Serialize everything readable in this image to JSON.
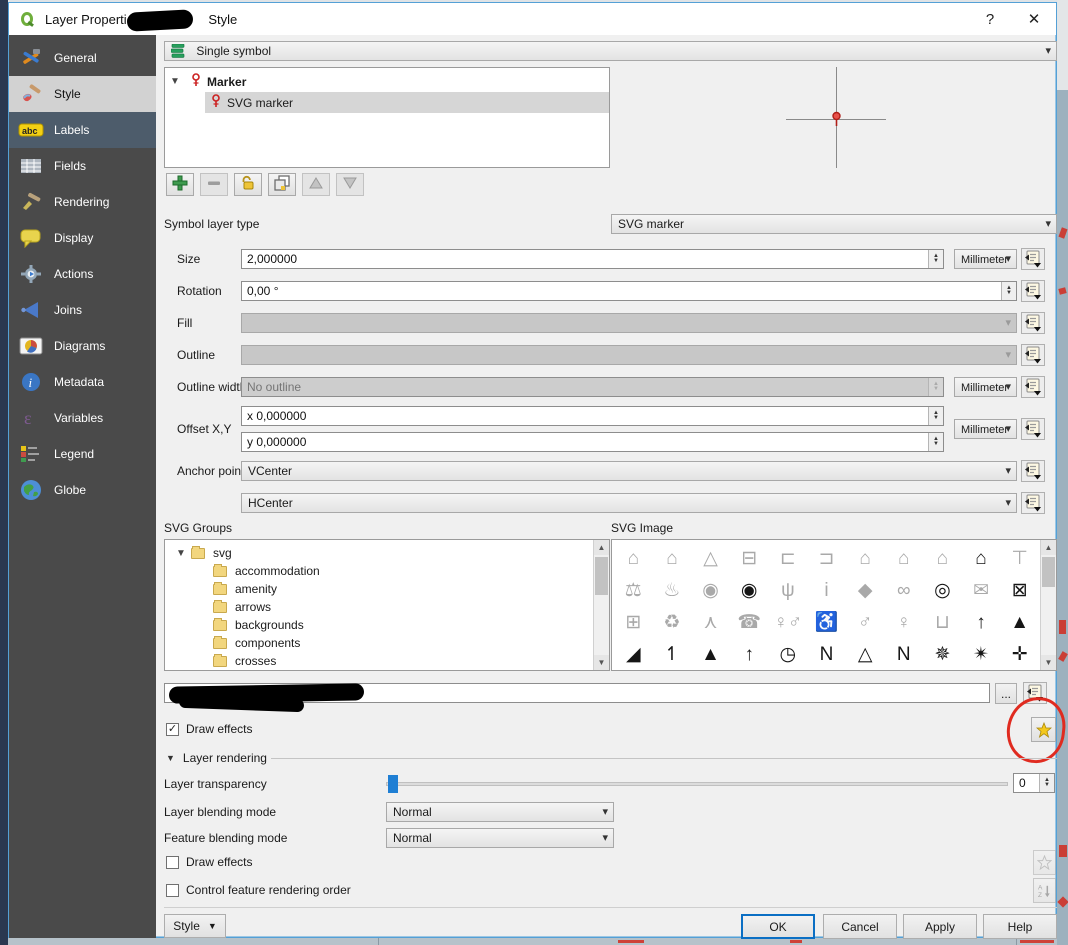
{
  "window": {
    "title": "Layer Properties - ",
    "title_suffix": "Style",
    "help_glyph": "?",
    "close_glyph": "✕"
  },
  "sidebar": {
    "items": [
      {
        "label": "General",
        "icon": "tools-icon",
        "name": "sidebar-item-general",
        "variant": "default"
      },
      {
        "label": "Style",
        "icon": "brush-icon",
        "name": "sidebar-item-style",
        "variant": "selected"
      },
      {
        "label": "Labels",
        "icon": "abc-icon",
        "name": "sidebar-item-labels",
        "variant": "tinted"
      },
      {
        "label": "Fields",
        "icon": "table-icon",
        "name": "sidebar-item-fields",
        "variant": "default"
      },
      {
        "label": "Rendering",
        "icon": "brush2-icon",
        "name": "sidebar-item-rendering",
        "variant": "default"
      },
      {
        "label": "Display",
        "icon": "bubble-icon",
        "name": "sidebar-item-display",
        "variant": "default"
      },
      {
        "label": "Actions",
        "icon": "gear-icon",
        "name": "sidebar-item-actions",
        "variant": "default"
      },
      {
        "label": "Joins",
        "icon": "megaphone-icon",
        "name": "sidebar-item-joins",
        "variant": "default"
      },
      {
        "label": "Diagrams",
        "icon": "chart-icon",
        "name": "sidebar-item-diagrams",
        "variant": "default"
      },
      {
        "label": "Metadata",
        "icon": "info-icon",
        "name": "sidebar-item-metadata",
        "variant": "default"
      },
      {
        "label": "Variables",
        "icon": "epsilon-icon",
        "name": "sidebar-item-variables",
        "variant": "default"
      },
      {
        "label": "Legend",
        "icon": "legend-icon",
        "name": "sidebar-item-legend",
        "variant": "default"
      },
      {
        "label": "Globe",
        "icon": "globe-icon",
        "name": "sidebar-item-globe",
        "variant": "default"
      }
    ]
  },
  "symbology": {
    "renderer": "Single symbol",
    "tree_parent": "Marker",
    "tree_child": "SVG marker"
  },
  "symbol_toolbar": {
    "buttons": [
      {
        "name": "add-symbol-layer-button",
        "icon": "plus-icon",
        "enabled": true
      },
      {
        "name": "remove-symbol-layer-button",
        "icon": "minus-icon",
        "enabled": false
      },
      {
        "name": "lock-color-button",
        "icon": "lock-icon",
        "enabled": true
      },
      {
        "name": "duplicate-symbol-layer-button",
        "icon": "duplicate-icon",
        "enabled": true
      },
      {
        "name": "move-up-button",
        "icon": "up-icon",
        "enabled": false
      },
      {
        "name": "move-down-button",
        "icon": "down-icon",
        "enabled": false
      }
    ]
  },
  "form": {
    "symbol_layer_type": {
      "label": "Symbol layer type",
      "value": "SVG marker"
    },
    "size": {
      "label": "Size",
      "value": "2,000000",
      "unit": "Millimeter"
    },
    "rotation": {
      "label": "Rotation",
      "value": "0,00 °"
    },
    "fill": {
      "label": "Fill"
    },
    "outline": {
      "label": "Outline"
    },
    "outline_width": {
      "label": "Outline width",
      "placeholder": "No outline",
      "unit": "Millimeter"
    },
    "offset": {
      "label": "Offset X,Y",
      "x_value": "x 0,000000",
      "y_value": "y 0,000000",
      "unit": "Millimeter"
    },
    "anchor": {
      "label": "Anchor point",
      "v_value": "VCenter",
      "h_value": "HCenter"
    }
  },
  "svg_groups": {
    "label": "SVG Groups",
    "root": "svg",
    "folders": [
      "accommodation",
      "amenity",
      "arrows",
      "backgrounds",
      "components",
      "crosses"
    ]
  },
  "svg_image": {
    "label": "SVG Image",
    "icons": [
      {
        "n": "shelter-hiker-icon",
        "g": "⌂",
        "c": "g"
      },
      {
        "n": "bed-breakfast-house-icon",
        "g": "⌂",
        "c": "g"
      },
      {
        "n": "tent-icon",
        "g": "△",
        "c": "g"
      },
      {
        "n": "caravan-icon",
        "g": "⊟",
        "c": "g"
      },
      {
        "n": "bed-breakfast-icon",
        "g": "⊏",
        "c": "g"
      },
      {
        "n": "hotel-bed-icon",
        "g": "⊐",
        "c": "g"
      },
      {
        "n": "house-icon",
        "g": "⌂",
        "c": "g"
      },
      {
        "n": "rain-shelter-icon",
        "g": "⌂",
        "c": "g"
      },
      {
        "n": "rain-shelter2-icon",
        "g": "⌂",
        "c": "g"
      },
      {
        "n": "house-trees-icon",
        "g": "⌂",
        "c": "b"
      },
      {
        "n": "picnic-table-icon",
        "g": "⊤",
        "c": "g"
      },
      {
        "n": "scales-justice-icon",
        "g": "⚖",
        "c": "g"
      },
      {
        "n": "fire-icon",
        "g": "♨",
        "c": "g"
      },
      {
        "n": "fire-badge-icon",
        "g": "◉",
        "c": "g"
      },
      {
        "n": "fire-badge-black-icon",
        "g": "◉",
        "c": "b"
      },
      {
        "n": "fountain-icon",
        "g": "ψ",
        "c": "g"
      },
      {
        "n": "information-icon",
        "g": "i",
        "c": "g"
      },
      {
        "n": "box-icon",
        "g": "◆",
        "c": "g"
      },
      {
        "n": "handcuffs-icon",
        "g": "∞",
        "c": "g"
      },
      {
        "n": "police-badge-icon",
        "g": "◎",
        "c": "b"
      },
      {
        "n": "envelope-icon",
        "g": "✉",
        "c": "g"
      },
      {
        "n": "envelope-circled-icon",
        "g": "⊠",
        "c": "b"
      },
      {
        "n": "gate-icon",
        "g": "⊞",
        "c": "g"
      },
      {
        "n": "recycling-icon",
        "g": "♻",
        "c": "g"
      },
      {
        "n": "tripod-icon",
        "g": "⋏",
        "c": "g"
      },
      {
        "n": "telephone-icon",
        "g": "☎",
        "c": "g"
      },
      {
        "n": "toilets-icon",
        "g": "♀♂",
        "c": "g"
      },
      {
        "n": "wheelchair-wc-icon",
        "g": "♿",
        "c": "g"
      },
      {
        "n": "toilets-men-icon",
        "g": "♂",
        "c": "g"
      },
      {
        "n": "toilets-women-icon",
        "g": "♀",
        "c": "g"
      },
      {
        "n": "waste-basket-icon",
        "g": "⊔",
        "c": "g"
      },
      {
        "n": "arrow-up-black-icon",
        "g": "↑",
        "c": "b"
      },
      {
        "n": "arrowhead-north-icon",
        "g": "▲",
        "c": "b"
      },
      {
        "n": "arrow-slim-icon",
        "g": "◢",
        "c": "b"
      },
      {
        "n": "arrow-flag-icon",
        "g": "↿",
        "c": "b"
      },
      {
        "n": "arrow-triangle-icon",
        "g": "▲",
        "c": "b"
      },
      {
        "n": "arrow-up2-icon",
        "g": "↑",
        "c": "b"
      },
      {
        "n": "clock-dial-icon",
        "g": "◷",
        "c": "b"
      },
      {
        "n": "north-n-icon",
        "g": "N",
        "c": "b"
      },
      {
        "n": "north-arrow-icon",
        "g": "△",
        "c": "b"
      },
      {
        "n": "north-n2-icon",
        "g": "N",
        "c": "b"
      },
      {
        "n": "compass-rose-icon",
        "g": "✵",
        "c": "b"
      },
      {
        "n": "compass-star-icon",
        "g": "✴",
        "c": "b"
      },
      {
        "n": "crosshair-point-icon",
        "g": "✛",
        "c": "b"
      }
    ]
  },
  "path_row": {
    "browse_label": "..."
  },
  "draw_effects_top": {
    "label": "Draw effects",
    "checked": "✓"
  },
  "layer_rendering": {
    "header": "Layer rendering",
    "transparency": {
      "label": "Layer transparency",
      "value": "0"
    },
    "layer_blending": {
      "label": "Layer blending mode",
      "value": "Normal"
    },
    "feature_blending": {
      "label": "Feature blending mode",
      "value": "Normal"
    },
    "draw_effects": {
      "label": "Draw effects"
    },
    "control_order": {
      "label": "Control feature rendering order"
    }
  },
  "footer": {
    "style_button": "Style",
    "ok": "OK",
    "cancel": "Cancel",
    "apply": "Apply",
    "help": "Help"
  },
  "colors": {
    "accent_blue": "#1f7fd4",
    "sidebar_bg": "#4a4a4a",
    "selected_bg": "#d2d2d2",
    "annotation_red": "#e02b20",
    "marker_red": "#cc2222"
  }
}
